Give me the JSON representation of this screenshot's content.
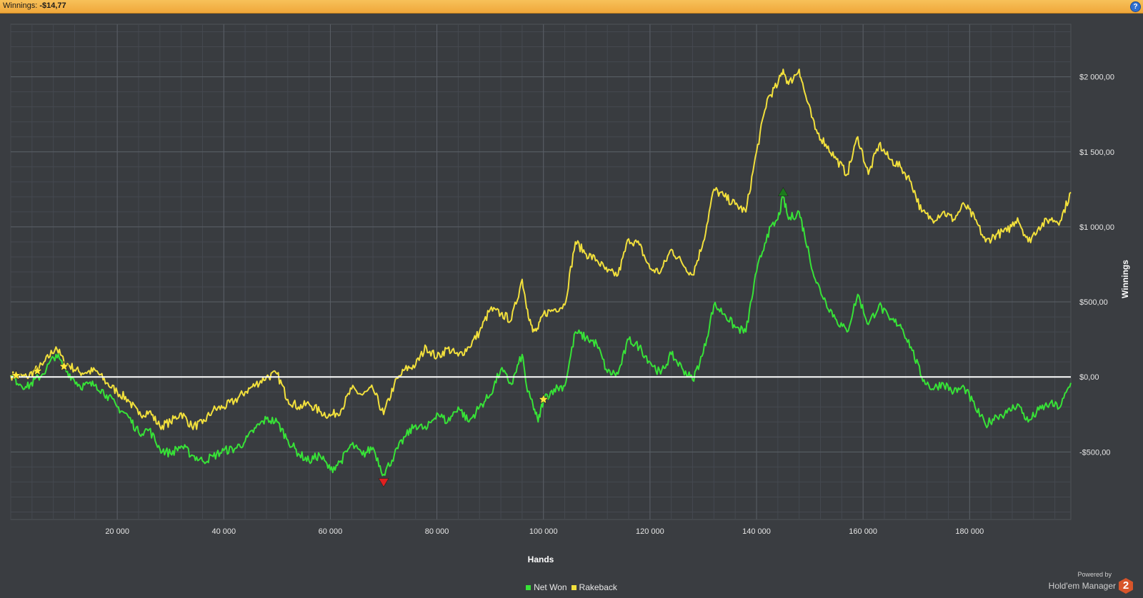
{
  "header": {
    "winnings_label": "Winnings:",
    "winnings_value": "-$14,77",
    "help_icon": "question-mark-icon",
    "accent_color": "#f0a73a"
  },
  "branding": {
    "powered_by": "Powered by",
    "product": "Hold'em Manager",
    "logo_text": "2",
    "logo_color": "#d8552a"
  },
  "chart_data": {
    "type": "line",
    "xlabel": "Hands",
    "ylabel": "Winnings",
    "xlim": [
      0,
      199000
    ],
    "ylim": [
      -950,
      2350
    ],
    "x_ticks": [
      20000,
      40000,
      60000,
      80000,
      100000,
      120000,
      140000,
      160000,
      180000
    ],
    "x_tick_labels": [
      "20 000",
      "40 000",
      "60 000",
      "80 000",
      "100 000",
      "120 000",
      "140 000",
      "160 000",
      "180 000"
    ],
    "y_ticks": [
      2000,
      1500,
      1000,
      500,
      0,
      -500
    ],
    "y_tick_labels": [
      "$2 000,00",
      "$1 500,00",
      "$1 000,00",
      "$500,00",
      "$0,00",
      "-$500,00"
    ],
    "grid": true,
    "legend_position": "bottom-center",
    "zero_line_color": "#ffffff",
    "background": "#3a3d41",
    "series": [
      {
        "name": "Net Won",
        "color": "#37e237",
        "points": [
          [
            0,
            0
          ],
          [
            3000,
            -70
          ],
          [
            6000,
            20
          ],
          [
            8500,
            150
          ],
          [
            10000,
            60
          ],
          [
            13000,
            -60
          ],
          [
            16000,
            -50
          ],
          [
            18000,
            -120
          ],
          [
            20000,
            -200
          ],
          [
            22000,
            -260
          ],
          [
            24000,
            -370
          ],
          [
            26000,
            -350
          ],
          [
            28000,
            -480
          ],
          [
            30000,
            -510
          ],
          [
            32000,
            -460
          ],
          [
            34000,
            -520
          ],
          [
            36000,
            -560
          ],
          [
            38000,
            -530
          ],
          [
            40000,
            -490
          ],
          [
            42000,
            -480
          ],
          [
            44000,
            -430
          ],
          [
            46000,
            -340
          ],
          [
            48000,
            -280
          ],
          [
            50000,
            -300
          ],
          [
            52000,
            -420
          ],
          [
            54000,
            -510
          ],
          [
            56000,
            -560
          ],
          [
            58000,
            -520
          ],
          [
            60000,
            -620
          ],
          [
            62000,
            -560
          ],
          [
            64000,
            -450
          ],
          [
            66000,
            -520
          ],
          [
            68000,
            -470
          ],
          [
            70000,
            -650
          ],
          [
            72000,
            -520
          ],
          [
            74000,
            -400
          ],
          [
            76000,
            -320
          ],
          [
            78000,
            -350
          ],
          [
            80000,
            -240
          ],
          [
            82000,
            -300
          ],
          [
            84000,
            -200
          ],
          [
            86000,
            -300
          ],
          [
            88000,
            -200
          ],
          [
            90000,
            -120
          ],
          [
            92000,
            50
          ],
          [
            94000,
            -50
          ],
          [
            96000,
            150
          ],
          [
            97000,
            -100
          ],
          [
            98000,
            -180
          ],
          [
            99000,
            -300
          ],
          [
            100000,
            -150
          ],
          [
            102000,
            -80
          ],
          [
            104000,
            -60
          ],
          [
            106000,
            300
          ],
          [
            108000,
            260
          ],
          [
            110000,
            220
          ],
          [
            112000,
            30
          ],
          [
            114000,
            20
          ],
          [
            116000,
            250
          ],
          [
            118000,
            200
          ],
          [
            120000,
            100
          ],
          [
            122000,
            20
          ],
          [
            124000,
            150
          ],
          [
            126000,
            60
          ],
          [
            128000,
            -20
          ],
          [
            130000,
            160
          ],
          [
            132000,
            480
          ],
          [
            134000,
            420
          ],
          [
            136000,
            330
          ],
          [
            138000,
            300
          ],
          [
            140000,
            700
          ],
          [
            142000,
            950
          ],
          [
            144000,
            1050
          ],
          [
            145000,
            1200
          ],
          [
            146000,
            1050
          ],
          [
            148000,
            1100
          ],
          [
            149000,
            950
          ],
          [
            151000,
            650
          ],
          [
            153000,
            500
          ],
          [
            155000,
            380
          ],
          [
            157000,
            300
          ],
          [
            159000,
            550
          ],
          [
            161000,
            350
          ],
          [
            163000,
            480
          ],
          [
            165000,
            380
          ],
          [
            167000,
            350
          ],
          [
            169000,
            200
          ],
          [
            171000,
            0
          ],
          [
            173000,
            -80
          ],
          [
            175000,
            -40
          ],
          [
            177000,
            -100
          ],
          [
            179000,
            -70
          ],
          [
            181000,
            -200
          ],
          [
            183000,
            -320
          ],
          [
            185000,
            -260
          ],
          [
            187000,
            -240
          ],
          [
            189000,
            -180
          ],
          [
            191000,
            -300
          ],
          [
            193000,
            -220
          ],
          [
            195000,
            -180
          ],
          [
            197000,
            -200
          ],
          [
            199000,
            -40
          ]
        ]
      },
      {
        "name": "Rakeback",
        "color": "#f2e03c",
        "points": [
          [
            0,
            10
          ],
          [
            3000,
            0
          ],
          [
            6000,
            80
          ],
          [
            8500,
            200
          ],
          [
            10000,
            100
          ],
          [
            13000,
            30
          ],
          [
            16000,
            40
          ],
          [
            18000,
            -40
          ],
          [
            20000,
            -100
          ],
          [
            22000,
            -150
          ],
          [
            24000,
            -250
          ],
          [
            26000,
            -230
          ],
          [
            28000,
            -330
          ],
          [
            30000,
            -300
          ],
          [
            32000,
            -240
          ],
          [
            34000,
            -330
          ],
          [
            36000,
            -310
          ],
          [
            38000,
            -220
          ],
          [
            40000,
            -200
          ],
          [
            42000,
            -160
          ],
          [
            44000,
            -100
          ],
          [
            46000,
            -50
          ],
          [
            48000,
            0
          ],
          [
            50000,
            20
          ],
          [
            52000,
            -150
          ],
          [
            54000,
            -200
          ],
          [
            56000,
            -180
          ],
          [
            58000,
            -230
          ],
          [
            60000,
            -260
          ],
          [
            62000,
            -220
          ],
          [
            64000,
            -80
          ],
          [
            66000,
            -120
          ],
          [
            68000,
            -80
          ],
          [
            70000,
            -250
          ],
          [
            72000,
            -50
          ],
          [
            74000,
            50
          ],
          [
            76000,
            80
          ],
          [
            78000,
            200
          ],
          [
            80000,
            130
          ],
          [
            82000,
            190
          ],
          [
            84000,
            140
          ],
          [
            86000,
            200
          ],
          [
            88000,
            300
          ],
          [
            90000,
            450
          ],
          [
            92000,
            420
          ],
          [
            94000,
            380
          ],
          [
            96000,
            650
          ],
          [
            97000,
            450
          ],
          [
            98000,
            300
          ],
          [
            99000,
            320
          ],
          [
            100000,
            420
          ],
          [
            102000,
            450
          ],
          [
            104000,
            480
          ],
          [
            106000,
            900
          ],
          [
            108000,
            820
          ],
          [
            110000,
            780
          ],
          [
            112000,
            700
          ],
          [
            114000,
            680
          ],
          [
            116000,
            920
          ],
          [
            118000,
            880
          ],
          [
            120000,
            720
          ],
          [
            122000,
            700
          ],
          [
            124000,
            850
          ],
          [
            126000,
            760
          ],
          [
            128000,
            680
          ],
          [
            130000,
            900
          ],
          [
            132000,
            1250
          ],
          [
            134000,
            1200
          ],
          [
            136000,
            1150
          ],
          [
            138000,
            1100
          ],
          [
            140000,
            1500
          ],
          [
            142000,
            1850
          ],
          [
            144000,
            1950
          ],
          [
            145000,
            2050
          ],
          [
            146000,
            1950
          ],
          [
            148000,
            2050
          ],
          [
            149000,
            1900
          ],
          [
            151000,
            1650
          ],
          [
            153000,
            1550
          ],
          [
            155000,
            1450
          ],
          [
            157000,
            1350
          ],
          [
            159000,
            1600
          ],
          [
            161000,
            1350
          ],
          [
            163000,
            1550
          ],
          [
            165000,
            1450
          ],
          [
            167000,
            1400
          ],
          [
            169000,
            1300
          ],
          [
            171000,
            1100
          ],
          [
            173000,
            1050
          ],
          [
            175000,
            1100
          ],
          [
            177000,
            1050
          ],
          [
            179000,
            1150
          ],
          [
            181000,
            1050
          ],
          [
            183000,
            900
          ],
          [
            185000,
            950
          ],
          [
            187000,
            970
          ],
          [
            189000,
            1060
          ],
          [
            191000,
            900
          ],
          [
            193000,
            1000
          ],
          [
            195000,
            1050
          ],
          [
            197000,
            1040
          ],
          [
            199000,
            1230
          ]
        ]
      }
    ],
    "markers": [
      {
        "type": "star",
        "color": "#ffe83a",
        "x": 1000,
        "y": 10
      },
      {
        "type": "star",
        "color": "#ffe83a",
        "x": 5000,
        "y": 40
      },
      {
        "type": "star",
        "color": "#ffe83a",
        "x": 10000,
        "y": 70
      },
      {
        "type": "star",
        "color": "#ffe83a",
        "x": 100000,
        "y": -150
      },
      {
        "type": "triangle-down",
        "color": "#e02020",
        "x": 70000,
        "y": -700
      },
      {
        "type": "triangle-up",
        "color": "#1c7a1c",
        "x": 145000,
        "y": 1230
      }
    ]
  }
}
